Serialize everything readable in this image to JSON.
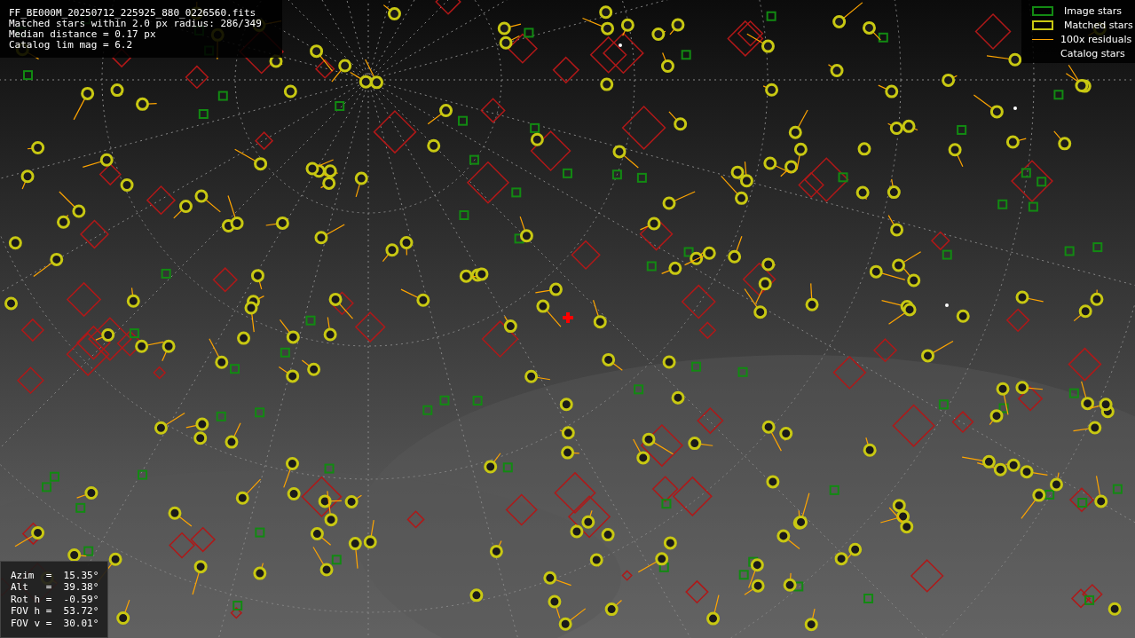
{
  "info": {
    "lines": [
      "FF_BE000M_20250712_225925_880_0226560.fits",
      "Matched stars within 2.0 px radius: 286/349",
      "Median distance = 0.17 px",
      "Catalog lim mag = 6.2"
    ]
  },
  "legend": [
    {
      "kind": "box",
      "label": "Image stars",
      "color": "#138a13"
    },
    {
      "kind": "box",
      "label": "Matched stars",
      "color": "#c8c812"
    },
    {
      "kind": "line",
      "label": "100x residuals",
      "color": "#ffa500"
    },
    {
      "kind": "none",
      "label": "Catalog stars"
    }
  ],
  "pointing": {
    "lines": [
      "Azim  =  15.35°",
      "Alt   =  39.38°",
      "Rot h =  -0.59°",
      "FOV h =  53.72°",
      "FOV v =  30.01°"
    ]
  }
}
